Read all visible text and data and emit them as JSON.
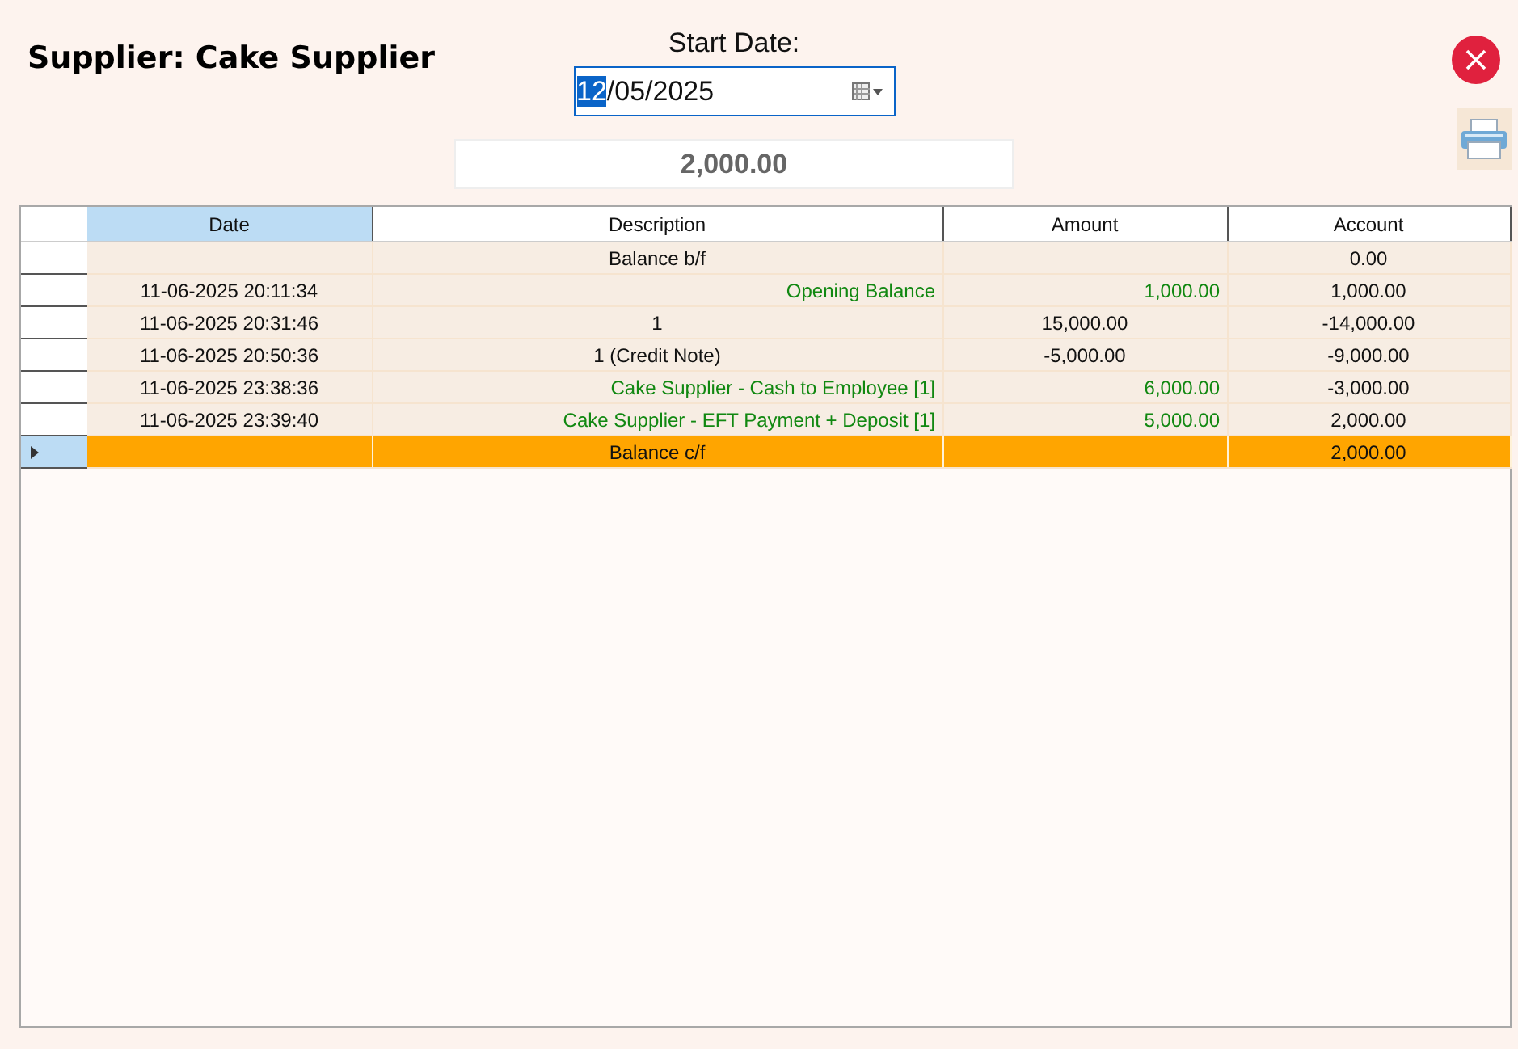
{
  "title": "Supplier: Cake Supplier",
  "start_date": {
    "label": "Start Date:",
    "segments": [
      {
        "text": "12",
        "selected": true
      },
      {
        "text": "/05/2025",
        "selected": false
      }
    ]
  },
  "total": "2,000.00",
  "table": {
    "columns": [
      {
        "label": "Date",
        "selected": true
      },
      {
        "label": "Description",
        "selected": false
      },
      {
        "label": "Amount",
        "selected": false
      },
      {
        "label": "Account",
        "selected": false
      }
    ],
    "rows": [
      {
        "kind": "balance",
        "selected": false,
        "description": "Balance b/f",
        "account": "0.00"
      },
      {
        "kind": "payment",
        "selected": false,
        "date": "11-06-2025 20:11:34",
        "description": "Opening Balance",
        "amount": "1,000.00",
        "account": "1,000.00"
      },
      {
        "kind": "entry",
        "selected": false,
        "date": "11-06-2025 20:31:46",
        "description": "1",
        "amount": "15,000.00",
        "account": "-14,000.00"
      },
      {
        "kind": "entry",
        "selected": false,
        "date": "11-06-2025 20:50:36",
        "description": "1 (Credit Note)",
        "amount": "-5,000.00",
        "account": "-9,000.00"
      },
      {
        "kind": "payment",
        "selected": false,
        "date": "11-06-2025 23:38:36",
        "description": "Cake Supplier - Cash to Employee [1]",
        "amount": "6,000.00",
        "account": "-3,000.00"
      },
      {
        "kind": "payment",
        "selected": false,
        "date": "11-06-2025 23:39:40",
        "description": "Cake Supplier - EFT Payment + Deposit [1]",
        "amount": "5,000.00",
        "account": "2,000.00"
      },
      {
        "kind": "balance",
        "selected": true,
        "description": "Balance c/f",
        "account": "2,000.00"
      }
    ]
  }
}
